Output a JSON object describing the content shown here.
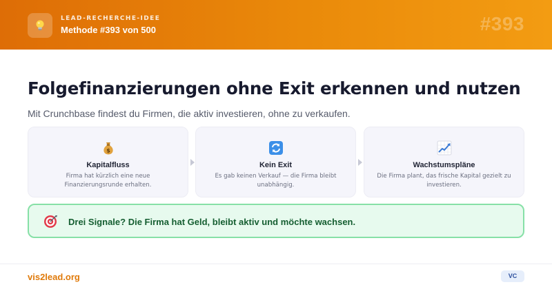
{
  "header": {
    "kicker": "LEAD-RECHERCHE-IDEE",
    "method": "Methode #393 von 500",
    "number": "#393",
    "badge_icon": "lightbulb-icon",
    "gradient": [
      "#de6d06",
      "#f39c12"
    ]
  },
  "main": {
    "title": "Folgefinanzierungen ohne Exit erkennen und nutzen",
    "subtitle": "Mit Crunchbase findest du Firmen, die aktiv investieren, ohne zu verkaufen."
  },
  "cards": [
    {
      "icon": "money-bag-icon",
      "title": "Kapitalfluss",
      "description": "Firma hat kürzlich eine neue Finanzierungsrunde erhalten."
    },
    {
      "icon": "cycle-arrows-icon",
      "title": "Kein Exit",
      "description": "Es gab keinen Verkauf — die Firma bleibt unabhängig."
    },
    {
      "icon": "growth-chart-icon",
      "title": "Wachstumspläne",
      "description": "Die Firma plant, das frische Kapital gezielt zu investieren."
    }
  ],
  "callout": {
    "icon": "target-icon",
    "text": "Drei Signale? Die Firma hat Geld, bleibt aktiv und möchte wachsen.",
    "colors": {
      "background": "#e7faee",
      "border": "#86e0a6",
      "text": "#155e31"
    }
  },
  "footer": {
    "site": "vis2lead.org",
    "tag": "VC",
    "site_color": "#e07a0a"
  }
}
